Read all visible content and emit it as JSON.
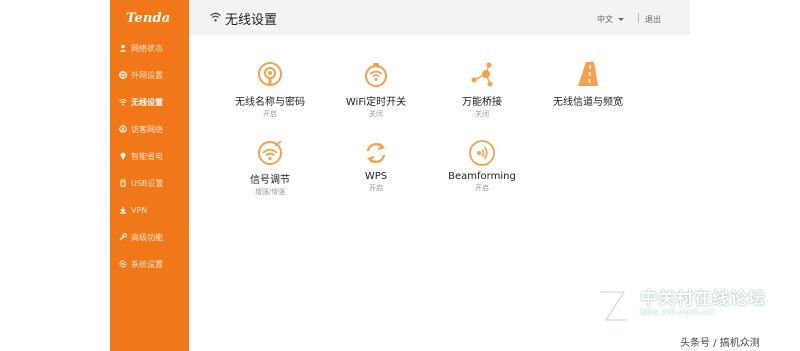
{
  "sidebar": {
    "logo": "Tenda",
    "items": [
      {
        "label": "网络状态",
        "icon": "user-icon",
        "active": false
      },
      {
        "label": "外网设置",
        "icon": "globe-icon",
        "active": false
      },
      {
        "label": "无线设置",
        "icon": "wifi-icon",
        "active": true
      },
      {
        "label": "访客网络",
        "icon": "guest-icon",
        "active": false
      },
      {
        "label": "智能省电",
        "icon": "bulb-icon",
        "active": false
      },
      {
        "label": "USB设置",
        "icon": "usb-icon",
        "active": false
      },
      {
        "label": "VPN",
        "icon": "download-icon",
        "active": false
      },
      {
        "label": "高级功能",
        "icon": "tools-icon",
        "active": false
      },
      {
        "label": "系统设置",
        "icon": "gear-icon",
        "active": false
      }
    ]
  },
  "header": {
    "title": "无线设置",
    "language": "中文",
    "logout": "退出"
  },
  "tiles": [
    {
      "label": "无线名称与密码",
      "status": "开启",
      "icon": "ssid-icon"
    },
    {
      "label": "WiFi定时开关",
      "status": "关闭",
      "icon": "timer-icon"
    },
    {
      "label": "万能桥接",
      "status": "关闭",
      "icon": "bridge-icon"
    },
    {
      "label": "无线信道与频宽",
      "status": "",
      "icon": "channel-icon"
    },
    {
      "label": "信号调节",
      "status": "增强/增强",
      "icon": "signal-adjust-icon"
    },
    {
      "label": "WPS",
      "status": "开启",
      "icon": "wps-icon"
    },
    {
      "label": "Beamforming",
      "status": "开启",
      "icon": "beamforming-icon"
    }
  ],
  "watermark": {
    "site": "中关村在线论坛",
    "url": "bbs.zol.com.cn",
    "credit": "头条号 / 搞机众测"
  },
  "colors": {
    "accent": "#f07818",
    "icon_orange": "#f5a04a",
    "background": "#f5f5f5"
  }
}
